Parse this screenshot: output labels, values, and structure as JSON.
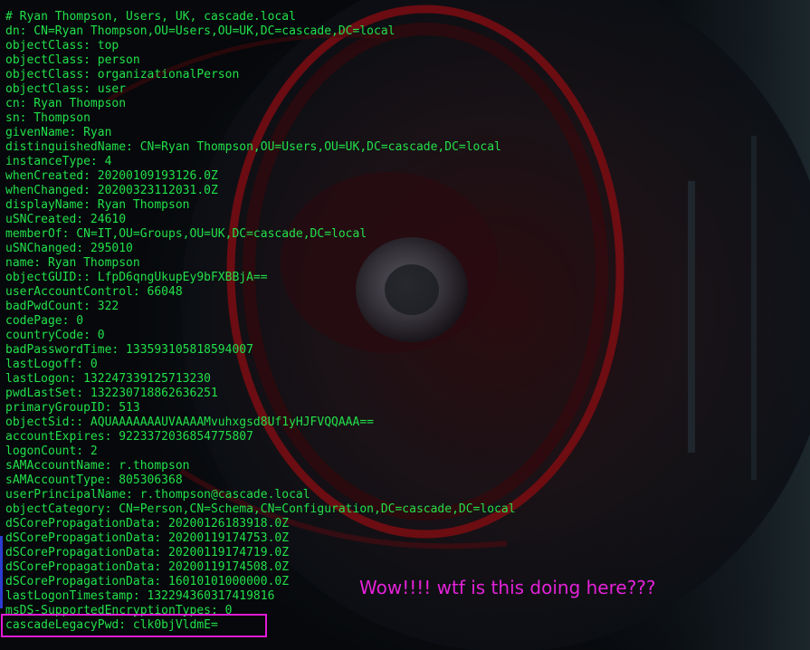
{
  "terminal": {
    "comment_line": "# Ryan Thompson, Users, UK, cascade.local",
    "lines": [
      "dn: CN=Ryan Thompson,OU=Users,OU=UK,DC=cascade,DC=local",
      "objectClass: top",
      "objectClass: person",
      "objectClass: organizationalPerson",
      "objectClass: user",
      "cn: Ryan Thompson",
      "sn: Thompson",
      "givenName: Ryan",
      "distinguishedName: CN=Ryan Thompson,OU=Users,OU=UK,DC=cascade,DC=local",
      "instanceType: 4",
      "whenCreated: 20200109193126.0Z",
      "whenChanged: 20200323112031.0Z",
      "displayName: Ryan Thompson",
      "uSNCreated: 24610",
      "memberOf: CN=IT,OU=Groups,OU=UK,DC=cascade,DC=local",
      "uSNChanged: 295010",
      "name: Ryan Thompson",
      "objectGUID:: LfpD6qngUkupEy9bFXBBjA==",
      "userAccountControl: 66048",
      "badPwdCount: 322",
      "codePage: 0",
      "countryCode: 0",
      "badPasswordTime: 133593105818594007",
      "lastLogoff: 0",
      "lastLogon: 132247339125713230",
      "pwdLastSet: 132230718862636251",
      "primaryGroupID: 513",
      "objectSid:: AQUAAAAAAAUVAAAAMvuhxgsd8Uf1yHJFVQQAAA==",
      "accountExpires: 9223372036854775807",
      "logonCount: 2",
      "sAMAccountName: r.thompson",
      "sAMAccountType: 805306368",
      "userPrincipalName: r.thompson@cascade.local",
      "objectCategory: CN=Person,CN=Schema,CN=Configuration,DC=cascade,DC=local",
      "dSCorePropagationData: 20200126183918.0Z",
      "dSCorePropagationData: 20200119174753.0Z",
      "dSCorePropagationData: 20200119174719.0Z",
      "dSCorePropagationData: 20200119174508.0Z",
      "dSCorePropagationData: 16010101000000.0Z",
      "lastLogonTimestamp: 132294360317419816",
      "msDS-SupportedEncryptionTypes: 0",
      "cascadeLegacyPwd: clk0bjVldmE="
    ]
  },
  "annotation": {
    "text": "Wow!!!! wtf is this doing here???"
  },
  "colors": {
    "terminal_text": "#22e04a",
    "annotation": "#e422d8",
    "highlight_border": "#e21ad6"
  }
}
